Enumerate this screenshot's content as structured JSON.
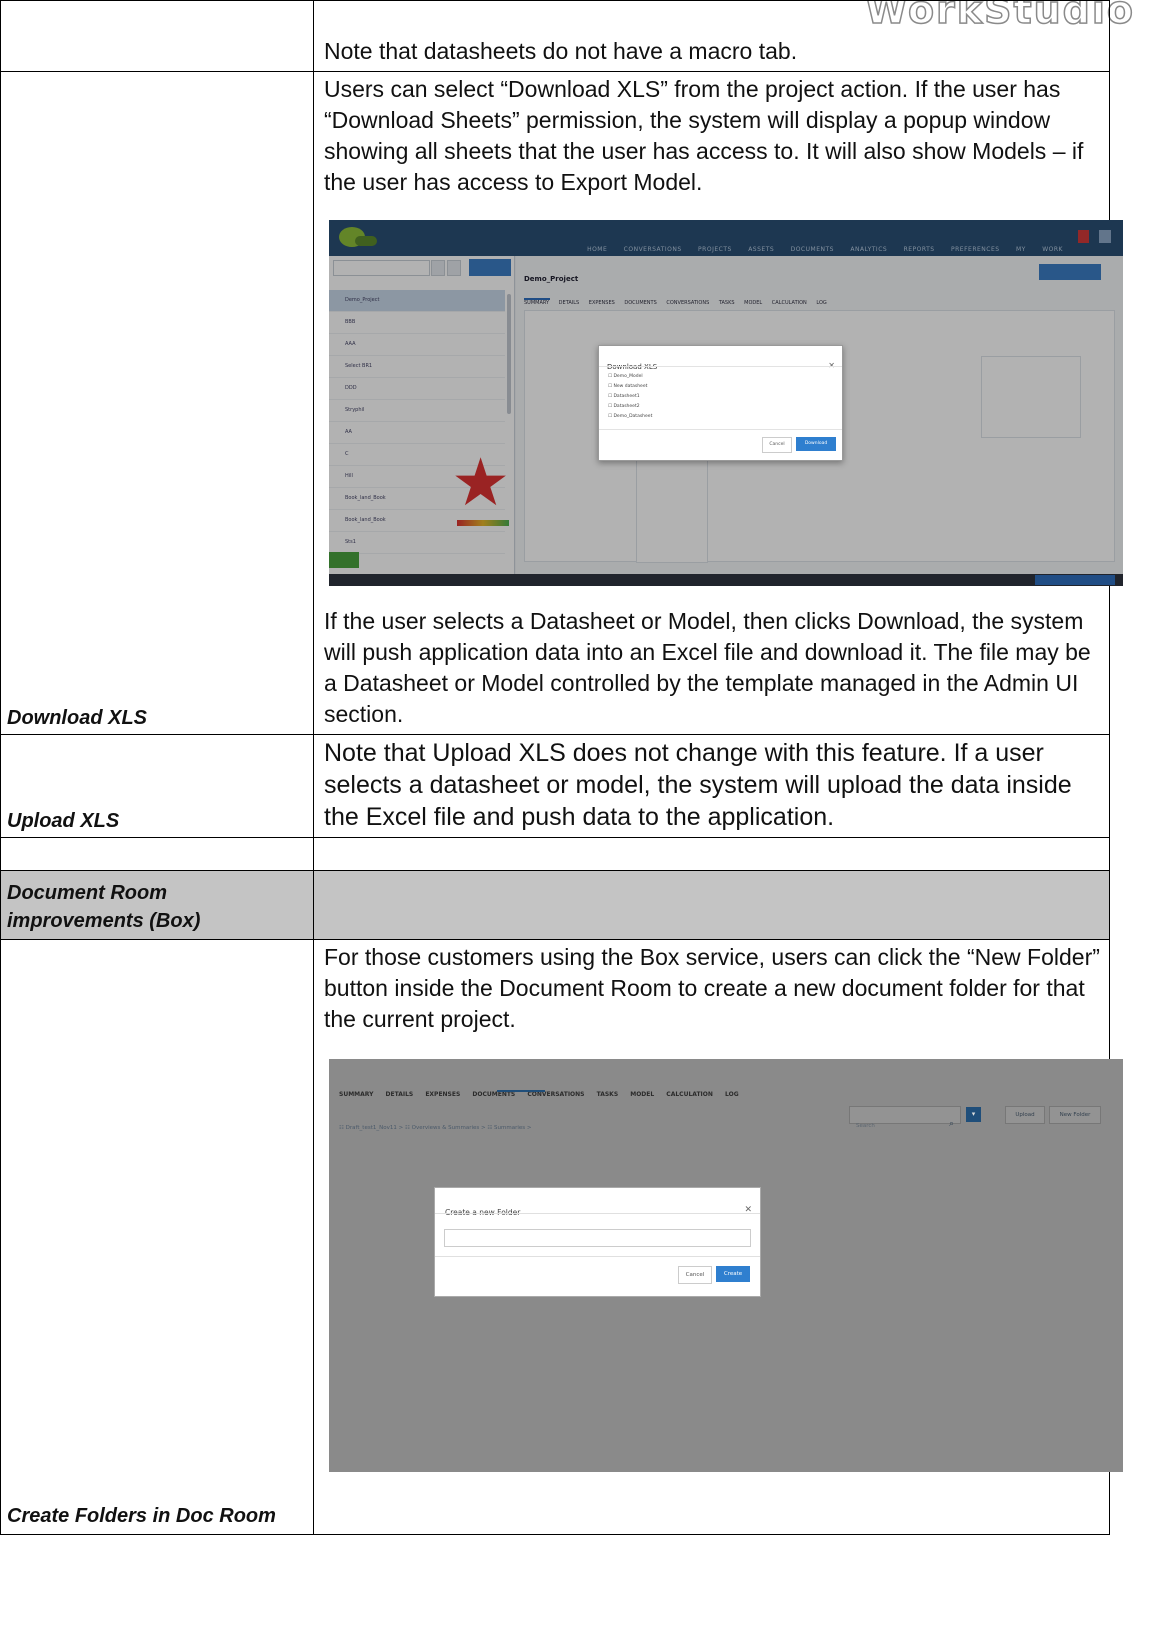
{
  "header_brand": "WorkStudio",
  "rows": {
    "r1_text": "Note that datasheets do not have a macro tab.",
    "r2_label": "Download XLS",
    "r2_intro": "Users can select “Download XLS” from the project action.  If the user has “Download Sheets” permission, the system will display a popup window showing all sheets that the user has access to.  It will also show Models – if the user has access to Export Model.",
    "r2_after": "If the user selects a Datasheet or Model, then clicks Download, the system will push application data into an Excel file and download it.  The file may be a Datasheet or Model controlled by the template managed in the Admin UI section.",
    "r3_label": "Upload XLS",
    "r3_text": "Note that Upload XLS does not change with this feature.  If a user selects a datasheet or model, the system will upload the data inside the Excel file and push data to the application.",
    "section_label": "Document Room improvements (Box)",
    "r5_label": "Create Folders in Doc Room",
    "r5_text": "For those customers using the Box service, users can click the “New Folder” button inside the Document Room to create a new document folder for that the current project."
  },
  "shot1": {
    "nav": "HOME CONVERSATIONS PROJECTS ASSETS DOCUMENTS ANALYTICS REPORTS PREFERENCES MY WORK",
    "project_title": "Demo_Project",
    "tabs": "SUMMARY DETAILS EXPENSES DOCUMENTS CONVERSATIONS TASKS MODEL CALCULATION LOG",
    "modal_title": "Download XLS",
    "options": [
      "Demo_Model",
      "New datasheet",
      "Datasheet1",
      "Datasheet2",
      "Demo_Datasheet"
    ],
    "cancel": "Cancel",
    "download": "Download",
    "sidebar_items": [
      "Demo_Project",
      "BBB",
      "AAA",
      "Select BR1",
      "DDD",
      "Stryphil",
      "AA",
      "C",
      "Hill",
      "Book_land_Book",
      "Book_land_Book",
      "Sts1"
    ]
  },
  "shot2": {
    "tabs": "SUMMARY DETAILS EXPENSES DOCUMENTS CONVERSATIONS TASKS MODEL CALCULATION LOG",
    "breadcrumb": "☷ Draft_test1_Nov11  > ☷ Overviews & Summaries  > ☷ Summaries  >",
    "search_placeholder": "Search",
    "upload": "Upload",
    "new_folder": "New Folder",
    "modal_title": "Create a new Folder",
    "field_label": "Folder Name",
    "cancel": "Cancel",
    "create": "Create"
  }
}
